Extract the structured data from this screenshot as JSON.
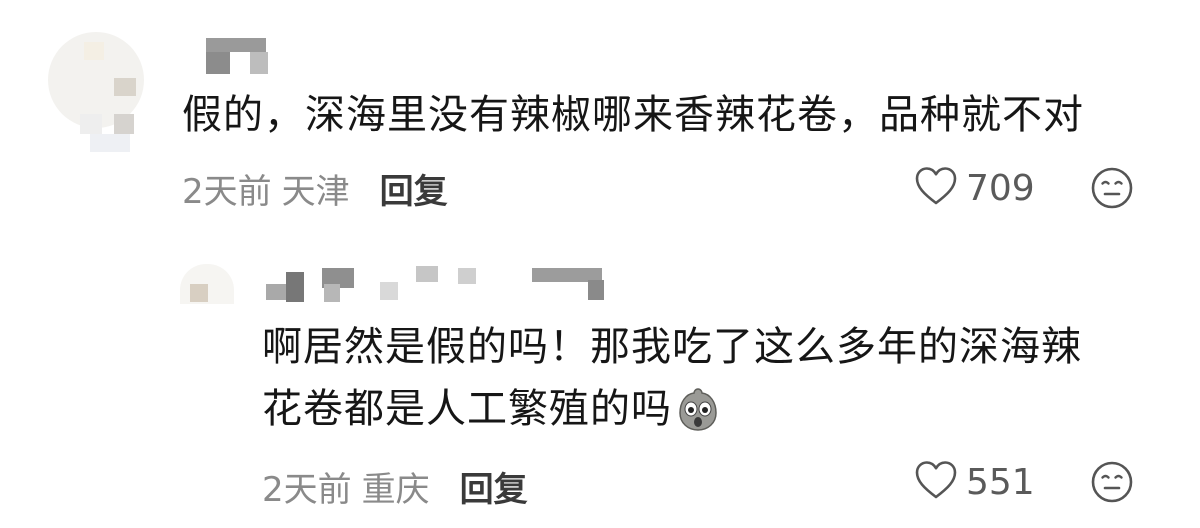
{
  "comments": [
    {
      "text": "假的，深海里没有辣椒哪来香辣花卷，品种就不对",
      "time": "2天前",
      "location": "天津",
      "reply_label": "回复",
      "likes": "709"
    },
    {
      "text_line1": "啊居然是假的吗！那我吃了这么多年的深海辣",
      "text_line2": "花卷都是人工繁殖的吗",
      "emoji": "shocked-face-emoji",
      "time": "2天前",
      "location": "重庆",
      "reply_label": "回复",
      "likes": "551"
    }
  ],
  "icons": {
    "like": "heart-outline-icon",
    "more": "neutral-face-icon"
  }
}
